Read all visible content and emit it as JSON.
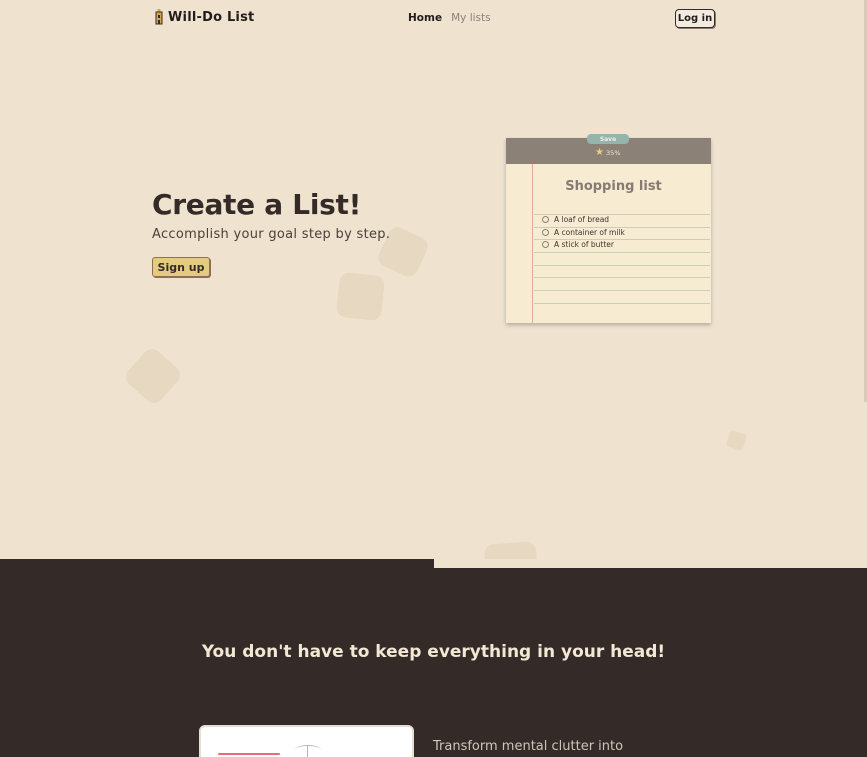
{
  "nav": {
    "brand_name": "Will-Do List",
    "brand_icon": "tower-icon",
    "links": [
      {
        "label": "Home",
        "active": true
      },
      {
        "label": "My lists",
        "active": false
      }
    ],
    "login_label": "Log in"
  },
  "hero": {
    "title": "Create a List!",
    "subtitle": "Accomplish your goal step by step.",
    "signup_label": "Sign up"
  },
  "note": {
    "save_label": "Save",
    "progress_text": "35%",
    "progress_icon": "star-icon",
    "title": "Shopping list",
    "items": [
      {
        "label": "A loaf of bread",
        "checked": false
      },
      {
        "label": "A container of milk",
        "checked": false
      },
      {
        "label": "A stick of butter",
        "checked": false
      }
    ]
  },
  "features": {
    "heading": "You don't have to keep everything in your head!",
    "text": "Transform mental clutter into"
  },
  "colors": {
    "background": "#efe3d0",
    "dark": "#342b29",
    "accent": "#e4cb80",
    "note_bar": "#8c8177",
    "save_tab": "#95b5ac"
  }
}
